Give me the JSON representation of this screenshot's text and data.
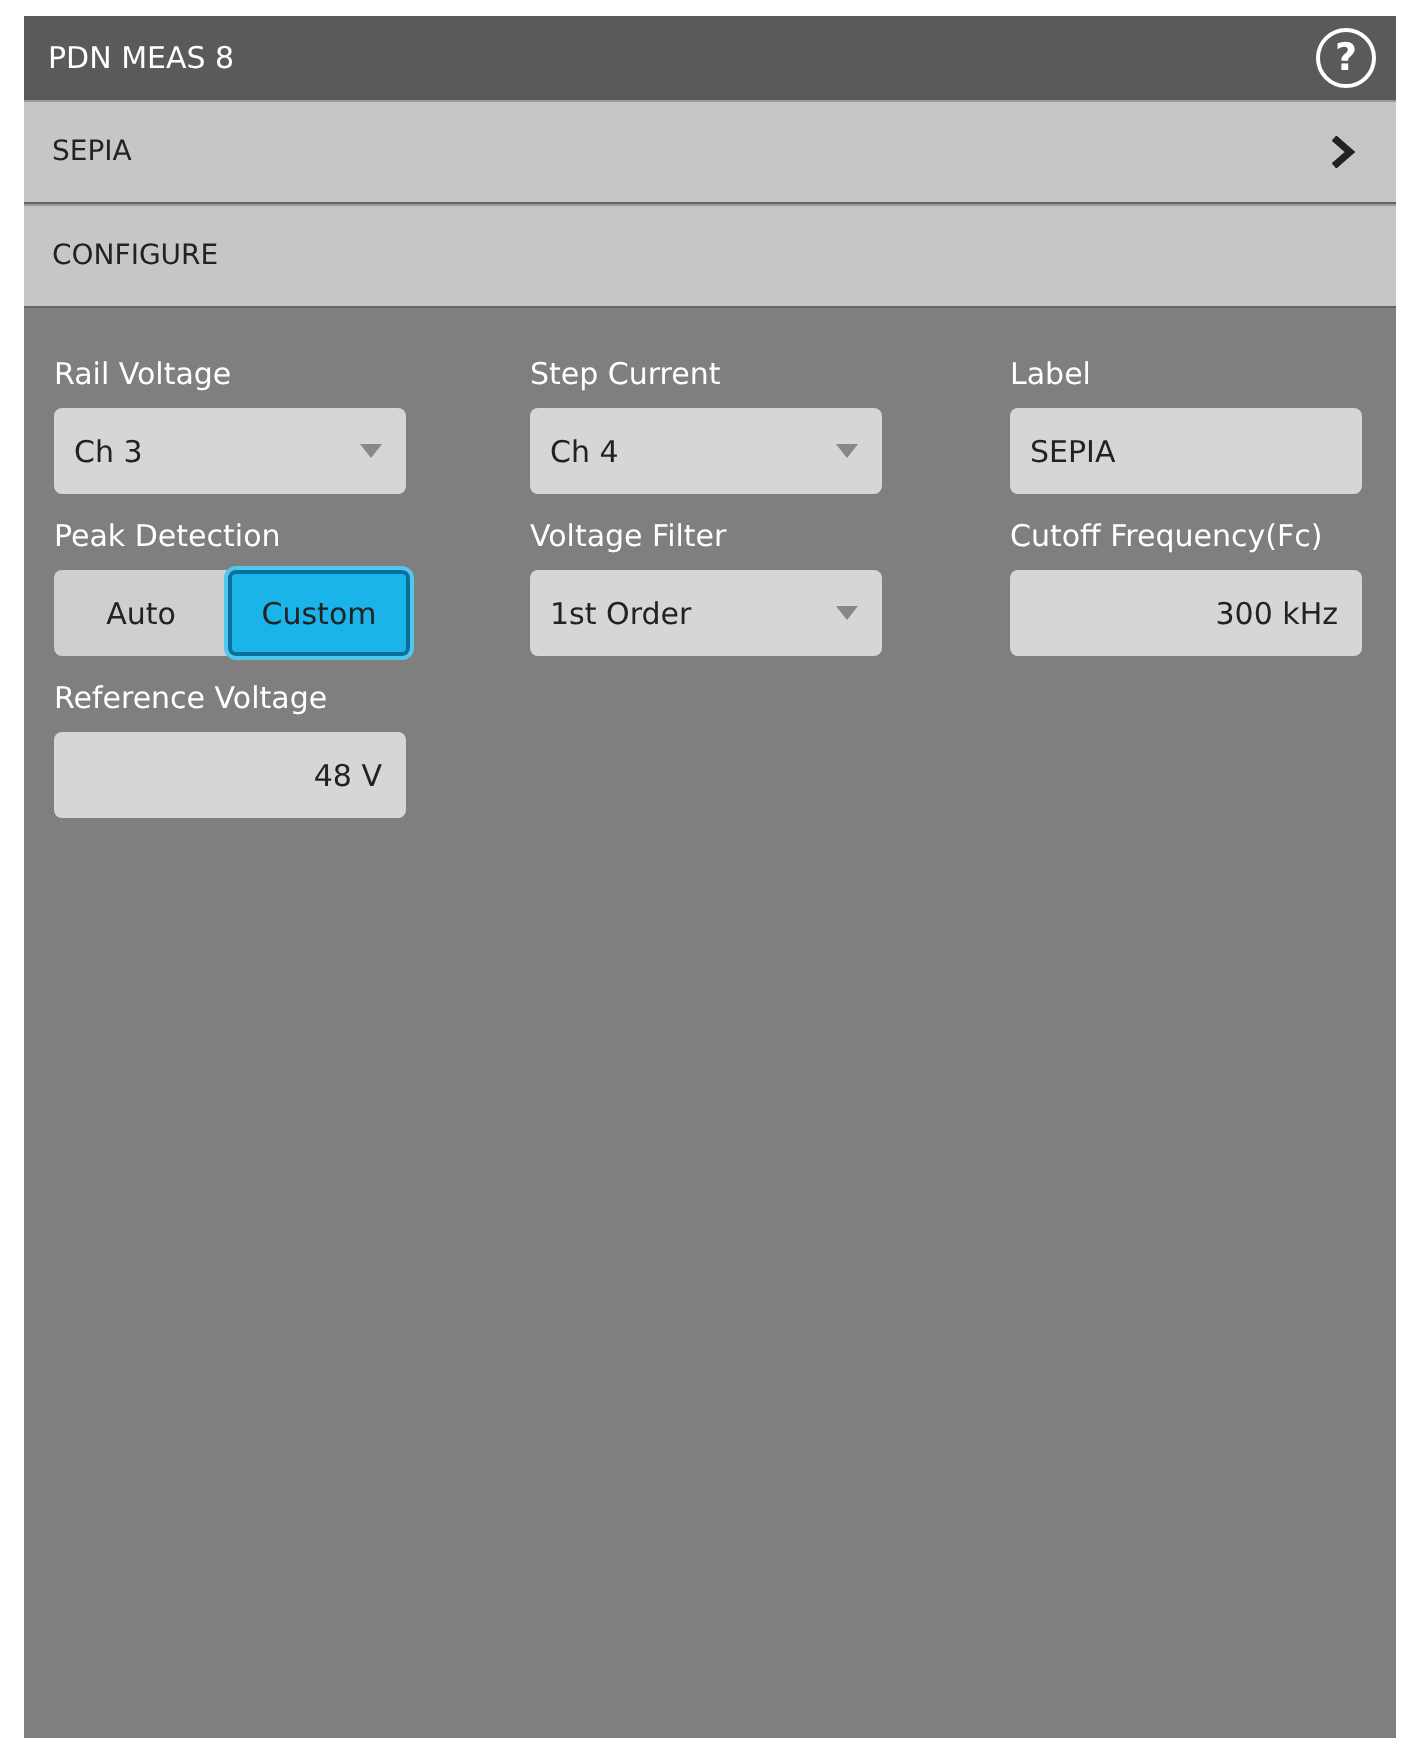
{
  "window": {
    "title": "PDN MEAS 8",
    "help": "?"
  },
  "sections": [
    {
      "label": "SEPIA",
      "kind": "link"
    },
    {
      "label": "CONFIGURE",
      "kind": "header"
    }
  ],
  "fields": [
    {
      "label": "Rail Voltage",
      "kind": "dropdown",
      "value": "Ch 3"
    },
    {
      "label": "Step Current",
      "kind": "dropdown",
      "value": "Ch 4"
    },
    {
      "label": "Label",
      "kind": "text",
      "value": "SEPIA"
    },
    {
      "label": "Peak Detection",
      "kind": "toggle",
      "options": [
        {
          "label": "Auto",
          "selected": false
        },
        {
          "label": "Custom",
          "selected": true
        }
      ]
    },
    {
      "label": "Voltage Filter",
      "kind": "dropdown",
      "value": "1st Order"
    },
    {
      "label": "Cutoff Frequency(Fc)",
      "kind": "number",
      "value": "300 kHz"
    },
    {
      "label": "Reference Voltage",
      "kind": "number",
      "value": "48 V"
    }
  ]
}
